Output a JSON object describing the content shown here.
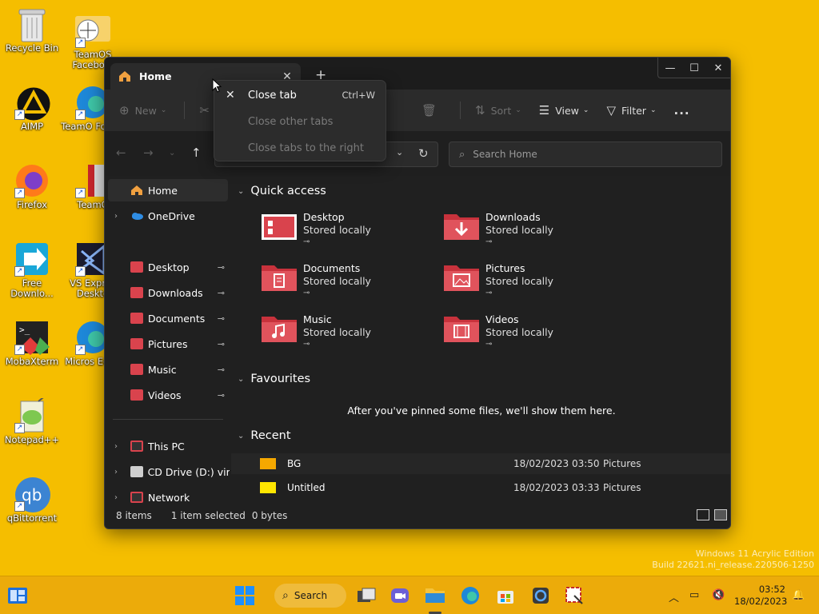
{
  "desktop": {
    "icons": [
      {
        "label": "Recycle Bin"
      },
      {
        "label": "TeamOS Facebo..."
      },
      {
        "label": "AIMP"
      },
      {
        "label": "TeamO Forum"
      },
      {
        "label": "Firefox"
      },
      {
        "label": "TeamO"
      },
      {
        "label": "Free Downlo..."
      },
      {
        "label": "VS Expres Deskto"
      },
      {
        "label": "MobaXterm"
      },
      {
        "label": "Micros Edge"
      },
      {
        "label": "Notepad++"
      },
      {
        "label": "qBittorrent"
      }
    ],
    "watermark": {
      "line1": "Windows 11 Acrylic Edition",
      "line2": "Build 22621.ni_release.220506-1250"
    }
  },
  "window": {
    "tab_title": "Home",
    "toolbar": {
      "new_label": "New",
      "sort_label": "Sort",
      "view_label": "View",
      "filter_label": "Filter",
      "more": "..."
    },
    "search_placeholder": "Search Home",
    "sidebar": {
      "home": "Home",
      "onedrive": "OneDrive",
      "pinned": [
        "Desktop",
        "Downloads",
        "Documents",
        "Pictures",
        "Music",
        "Videos"
      ],
      "this_pc": "This PC",
      "cd_drive": "CD Drive (D:) virtio-",
      "network": "Network"
    },
    "quick_access": {
      "title": "Quick access",
      "items": [
        {
          "name": "Desktop",
          "status": "Stored locally"
        },
        {
          "name": "Downloads",
          "status": "Stored locally"
        },
        {
          "name": "Documents",
          "status": "Stored locally"
        },
        {
          "name": "Pictures",
          "status": "Stored locally"
        },
        {
          "name": "Music",
          "status": "Stored locally"
        },
        {
          "name": "Videos",
          "status": "Stored locally"
        }
      ]
    },
    "favourites": {
      "title": "Favourites",
      "empty_text": "After you've pinned some files, we'll show them here."
    },
    "recent": {
      "title": "Recent",
      "rows": [
        {
          "name": "BG",
          "date": "18/02/2023 03:50",
          "location": "Pictures",
          "color": "#f5a800"
        },
        {
          "name": "Untitled",
          "date": "18/02/2023 03:33",
          "location": "Pictures",
          "color": "#ffe600"
        }
      ]
    },
    "status": {
      "items": "8 items",
      "selection": "1 item selected",
      "size": "0 bytes"
    }
  },
  "context_menu": {
    "items": [
      {
        "label": "Close tab",
        "shortcut": "Ctrl+W"
      },
      {
        "label": "Close other tabs"
      },
      {
        "label": "Close tabs to the right"
      }
    ]
  },
  "taskbar": {
    "search_label": "Search",
    "time": "03:52",
    "date": "18/02/2023"
  },
  "colors": {
    "desktop_bg": "#f5be00",
    "taskbar_bg": "#ecab0a",
    "folder_red": "#d9434d",
    "window_bg": "#202020"
  }
}
